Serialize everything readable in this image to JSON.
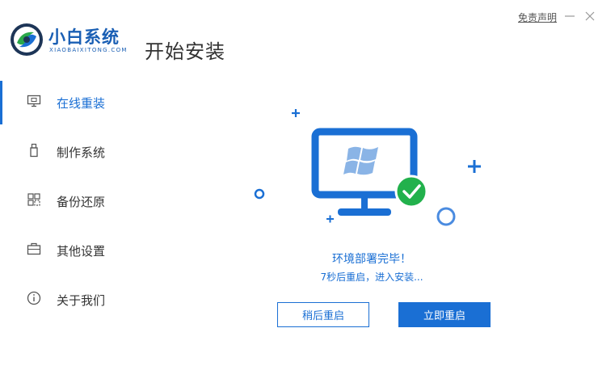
{
  "header": {
    "brand_name": "小白系统",
    "brand_sub": "XIAOBAIXITONG.COM",
    "page_title": "开始安装",
    "disclaimer": "免责声明"
  },
  "sidebar": {
    "items": [
      {
        "label": "在线重装",
        "icon": "monitor-icon",
        "active": true
      },
      {
        "label": "制作系统",
        "icon": "usb-icon",
        "active": false
      },
      {
        "label": "备份还原",
        "icon": "backup-icon",
        "active": false
      },
      {
        "label": "其他设置",
        "icon": "briefcase-icon",
        "active": false
      },
      {
        "label": "关于我们",
        "icon": "info-icon",
        "active": false
      }
    ]
  },
  "status": {
    "title": "环境部署完毕！",
    "countdown": "7秒后重启，进入安装..."
  },
  "actions": {
    "later_label": "稍后重启",
    "now_label": "立即重启"
  },
  "colors": {
    "accent": "#1a6fd4",
    "brand": "#1a5fb4",
    "success": "#22b14c"
  }
}
